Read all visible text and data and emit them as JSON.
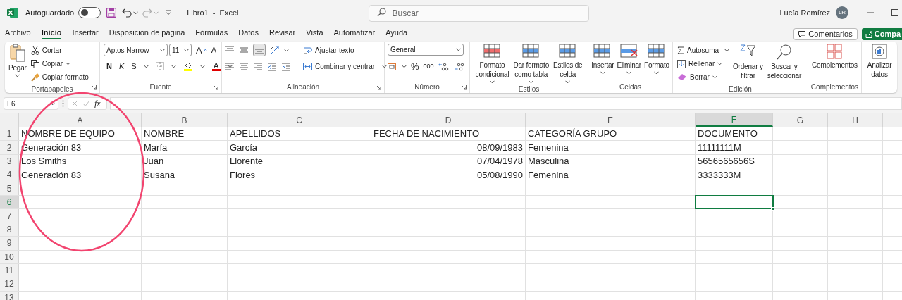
{
  "title_bar": {
    "autosave_label": "Autoguardado",
    "autosave_on": false,
    "document_title": "Libro1  -  Excel",
    "search": {
      "placeholder": "Buscar"
    },
    "user_name": "Lucía Remírez",
    "user_initials": "LR"
  },
  "tabs": [
    {
      "label": "Archivo",
      "selected": false
    },
    {
      "label": "Inicio",
      "selected": true
    },
    {
      "label": "Insertar",
      "selected": false
    },
    {
      "label": "Disposición de página",
      "selected": false
    },
    {
      "label": "Fórmulas",
      "selected": false
    },
    {
      "label": "Datos",
      "selected": false
    },
    {
      "label": "Revisar",
      "selected": false
    },
    {
      "label": "Vista",
      "selected": false
    },
    {
      "label": "Automatizar",
      "selected": false
    },
    {
      "label": "Ayuda",
      "selected": false
    }
  ],
  "comments_button": "Comentarios",
  "share_button": "Compa",
  "ribbon": {
    "clipboard": {
      "label": "Portapapeles",
      "paste": "Pegar",
      "cut": "Cortar",
      "copy": "Copiar",
      "format_painter": "Copiar formato"
    },
    "font": {
      "label": "Fuente",
      "font_name": "Aptos Narrow",
      "font_size": "11",
      "grow": "A",
      "shrink": "A",
      "bold": "N",
      "italic": "K",
      "underline": "S",
      "font_color": "A"
    },
    "alignment": {
      "label": "Alineación",
      "wrap_text": "Ajustar texto",
      "merge_center": "Combinar y centrar"
    },
    "number": {
      "label": "Número",
      "format": "General",
      "percent": "%",
      "thousands": "000"
    },
    "styles": {
      "label": "Estilos",
      "conditional": [
        "Formato",
        "condicional"
      ],
      "as_table": [
        "Dar formato",
        "como tabla"
      ],
      "cell_styles": [
        "Estilos de",
        "celda"
      ]
    },
    "cells": {
      "label": "Celdas",
      "insert": "Insertar",
      "delete": "Eliminar",
      "format": "Formato"
    },
    "editing": {
      "label": "Edición",
      "autosum": "Autosuma",
      "fill": "Rellenar",
      "clear": "Borrar",
      "sort_filter": [
        "Ordenar y",
        "filtrar"
      ],
      "find_select": [
        "Buscar y",
        "seleccionar"
      ]
    },
    "addins": {
      "label": "Complementos",
      "addins": "Complementos"
    },
    "analysis": {
      "analyze": [
        "Analizar",
        "datos"
      ]
    }
  },
  "formula_bar": {
    "name_box": "F6",
    "function_symbol": "fx"
  },
  "sheet": {
    "columns": [
      {
        "label": "A",
        "selected": false
      },
      {
        "label": "B",
        "selected": false
      },
      {
        "label": "C",
        "selected": false
      },
      {
        "label": "D",
        "selected": false
      },
      {
        "label": "E",
        "selected": false
      },
      {
        "label": "F",
        "selected": true
      },
      {
        "label": "G",
        "selected": false
      },
      {
        "label": "H",
        "selected": false
      }
    ],
    "rows": [
      {
        "label": "1",
        "selected": false,
        "cells": [
          {
            "text": "NOMBRE DE EQUIPO",
            "kind": "text"
          },
          {
            "text": "NOMBRE",
            "kind": "text"
          },
          {
            "text": "APELLIDOS",
            "kind": "text"
          },
          {
            "text": "FECHA DE NACIMIENTO",
            "kind": "text"
          },
          {
            "text": "CATEGORÍA GRUPO",
            "kind": "text"
          },
          {
            "text": "DOCUMENTO",
            "kind": "text"
          }
        ]
      },
      {
        "label": "2",
        "selected": false,
        "cells": [
          {
            "text": "Generación 83",
            "kind": "text"
          },
          {
            "text": "María",
            "kind": "text"
          },
          {
            "text": "García",
            "kind": "text"
          },
          {
            "text": "08/09/1983",
            "kind": "date"
          },
          {
            "text": "Femenina",
            "kind": "text"
          },
          {
            "text": "11111111M",
            "kind": "text"
          }
        ]
      },
      {
        "label": "3",
        "selected": false,
        "cells": [
          {
            "text": "Los Smiths",
            "kind": "text"
          },
          {
            "text": "Juan",
            "kind": "text"
          },
          {
            "text": "Llorente",
            "kind": "text"
          },
          {
            "text": "07/04/1978",
            "kind": "date"
          },
          {
            "text": "Masculina",
            "kind": "text"
          },
          {
            "text": "5656565656S",
            "kind": "text"
          }
        ]
      },
      {
        "label": "4",
        "selected": false,
        "cells": [
          {
            "text": "Generación 83",
            "kind": "text"
          },
          {
            "text": "Susana",
            "kind": "text"
          },
          {
            "text": "Flores",
            "kind": "text"
          },
          {
            "text": "05/08/1990",
            "kind": "date"
          },
          {
            "text": "Femenina",
            "kind": "text"
          },
          {
            "text": "3333333M",
            "kind": "text"
          }
        ]
      },
      {
        "label": "5",
        "selected": false
      },
      {
        "label": "6",
        "selected": true
      },
      {
        "label": "7",
        "selected": false
      },
      {
        "label": "8",
        "selected": false
      },
      {
        "label": "9",
        "selected": false
      },
      {
        "label": "10",
        "selected": false
      },
      {
        "label": "11",
        "selected": false
      },
      {
        "label": "12",
        "selected": false
      },
      {
        "label": "13",
        "selected": false
      }
    ]
  }
}
